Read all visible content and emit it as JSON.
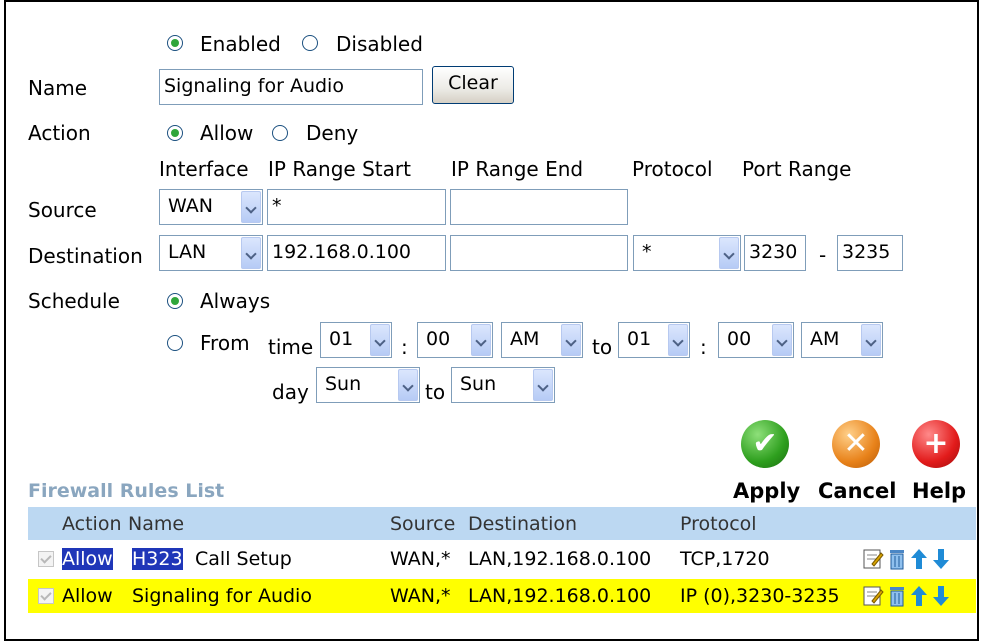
{
  "status": {
    "enabled_label": "Enabled",
    "disabled_label": "Disabled",
    "selected": "Enabled"
  },
  "name": {
    "label": "Name",
    "value": "Signaling for Audio",
    "clear_label": "Clear"
  },
  "action": {
    "label": "Action",
    "allow_label": "Allow",
    "deny_label": "Deny",
    "selected": "Allow"
  },
  "columns": {
    "interface": "Interface",
    "ip_start": "IP Range Start",
    "ip_end": "IP Range End",
    "protocol": "Protocol",
    "port_range": "Port Range"
  },
  "source": {
    "label": "Source",
    "interface": "WAN",
    "ip_start": "*",
    "ip_end": ""
  },
  "destination": {
    "label": "Destination",
    "interface": "LAN",
    "ip_start": "192.168.0.100",
    "ip_end": "",
    "protocol": "*",
    "port_start": "3230",
    "port_sep": "-",
    "port_end": "3235"
  },
  "schedule": {
    "label": "Schedule",
    "always_label": "Always",
    "from_label": "From",
    "time_label": "time",
    "time_from_hour": "01",
    "time_from_min": "00",
    "time_from_ampm": "AM",
    "colon": ":",
    "to_label": "to",
    "time_to_hour": "01",
    "time_to_min": "00",
    "time_to_ampm": "AM",
    "day_label": "day",
    "day_from": "Sun",
    "day_to": "Sun",
    "selected": "Always"
  },
  "buttons": {
    "apply": "Apply",
    "cancel": "Cancel",
    "help": "Help"
  },
  "rules": {
    "title": "Firewall Rules List",
    "headers": {
      "action": "Action",
      "name": "Name",
      "source": "Source",
      "destination": "Destination",
      "protocol": "Protocol"
    },
    "rows": [
      {
        "action": "Allow",
        "name_part1": "H323",
        "name_part2": "Call Setup",
        "source": "WAN,*",
        "destination": "LAN,192.168.0.100",
        "protocol": "TCP,1720"
      },
      {
        "action": "Allow",
        "name": "Signaling for Audio",
        "source": "WAN,*",
        "destination": "LAN,192.168.0.100",
        "protocol": "IP (0),3230-3235"
      }
    ]
  },
  "colors": {
    "apply": "#2e9f1e",
    "cancel": "#e8821a",
    "help": "#e21b1b",
    "header_bg": "#bcd8f2",
    "highlight": "#ffff00",
    "title": "#8aa6bf"
  },
  "icons": {
    "edit": "edit-icon",
    "delete": "trash-icon",
    "up": "arrow-up-icon",
    "down": "arrow-down-icon",
    "apply": "checkmark-icon",
    "cancel": "x-icon",
    "help": "plus-icon"
  }
}
